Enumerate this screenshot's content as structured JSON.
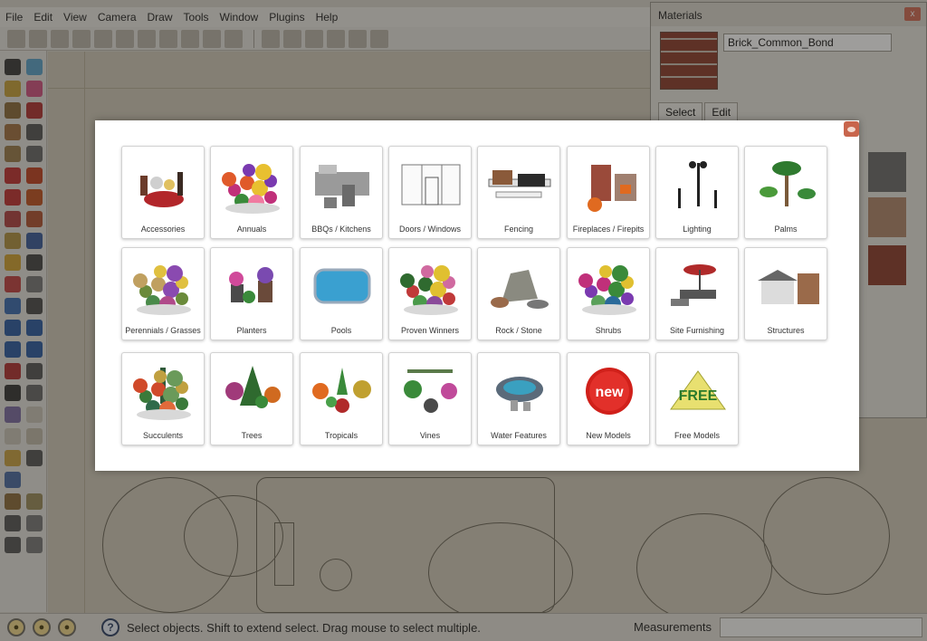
{
  "menu": [
    "File",
    "Edit",
    "View",
    "Camera",
    "Draw",
    "Tools",
    "Window",
    "Plugins",
    "Help"
  ],
  "materials_panel": {
    "title": "Materials",
    "material_name": "Brick_Common_Bond",
    "tabs": [
      "Select",
      "Edit"
    ]
  },
  "status": {
    "hint": "Select objects. Shift to extend select. Drag mouse to select multiple.",
    "measurements_label": "Measurements",
    "help_glyph": "?"
  },
  "modal": {
    "categories": [
      {
        "label": "Accessories",
        "icon": "accessories-icon"
      },
      {
        "label": "Annuals",
        "icon": "annuals-icon"
      },
      {
        "label": "BBQs / Kitchens",
        "icon": "bbq-kitchen-icon"
      },
      {
        "label": "Doors / Windows",
        "icon": "doors-windows-icon"
      },
      {
        "label": "Fencing",
        "icon": "fencing-icon"
      },
      {
        "label": "Fireplaces / Firepits",
        "icon": "fireplace-icon"
      },
      {
        "label": "Lighting",
        "icon": "lighting-icon"
      },
      {
        "label": "Palms",
        "icon": "palms-icon"
      },
      {
        "label": "Perennials / Grasses",
        "icon": "perennials-icon"
      },
      {
        "label": "Planters",
        "icon": "planters-icon"
      },
      {
        "label": "Pools",
        "icon": "pool-icon"
      },
      {
        "label": "Proven Winners",
        "icon": "proven-winners-icon"
      },
      {
        "label": "Rock / Stone",
        "icon": "rock-stone-icon"
      },
      {
        "label": "Shrubs",
        "icon": "shrubs-icon"
      },
      {
        "label": "Site Furnishing",
        "icon": "site-furnishing-icon"
      },
      {
        "label": "Structures",
        "icon": "structures-icon"
      },
      {
        "label": "Succulents",
        "icon": "succulents-icon"
      },
      {
        "label": "Trees",
        "icon": "trees-icon"
      },
      {
        "label": "Tropicals",
        "icon": "tropicals-icon"
      },
      {
        "label": "Vines",
        "icon": "vines-icon"
      },
      {
        "label": "Water Features",
        "icon": "water-features-icon"
      },
      {
        "label": "New Models",
        "icon": "new-badge-icon",
        "badge_text": "new"
      },
      {
        "label": "Free Models",
        "icon": "free-sign-icon",
        "badge_text": "FREE"
      }
    ]
  }
}
